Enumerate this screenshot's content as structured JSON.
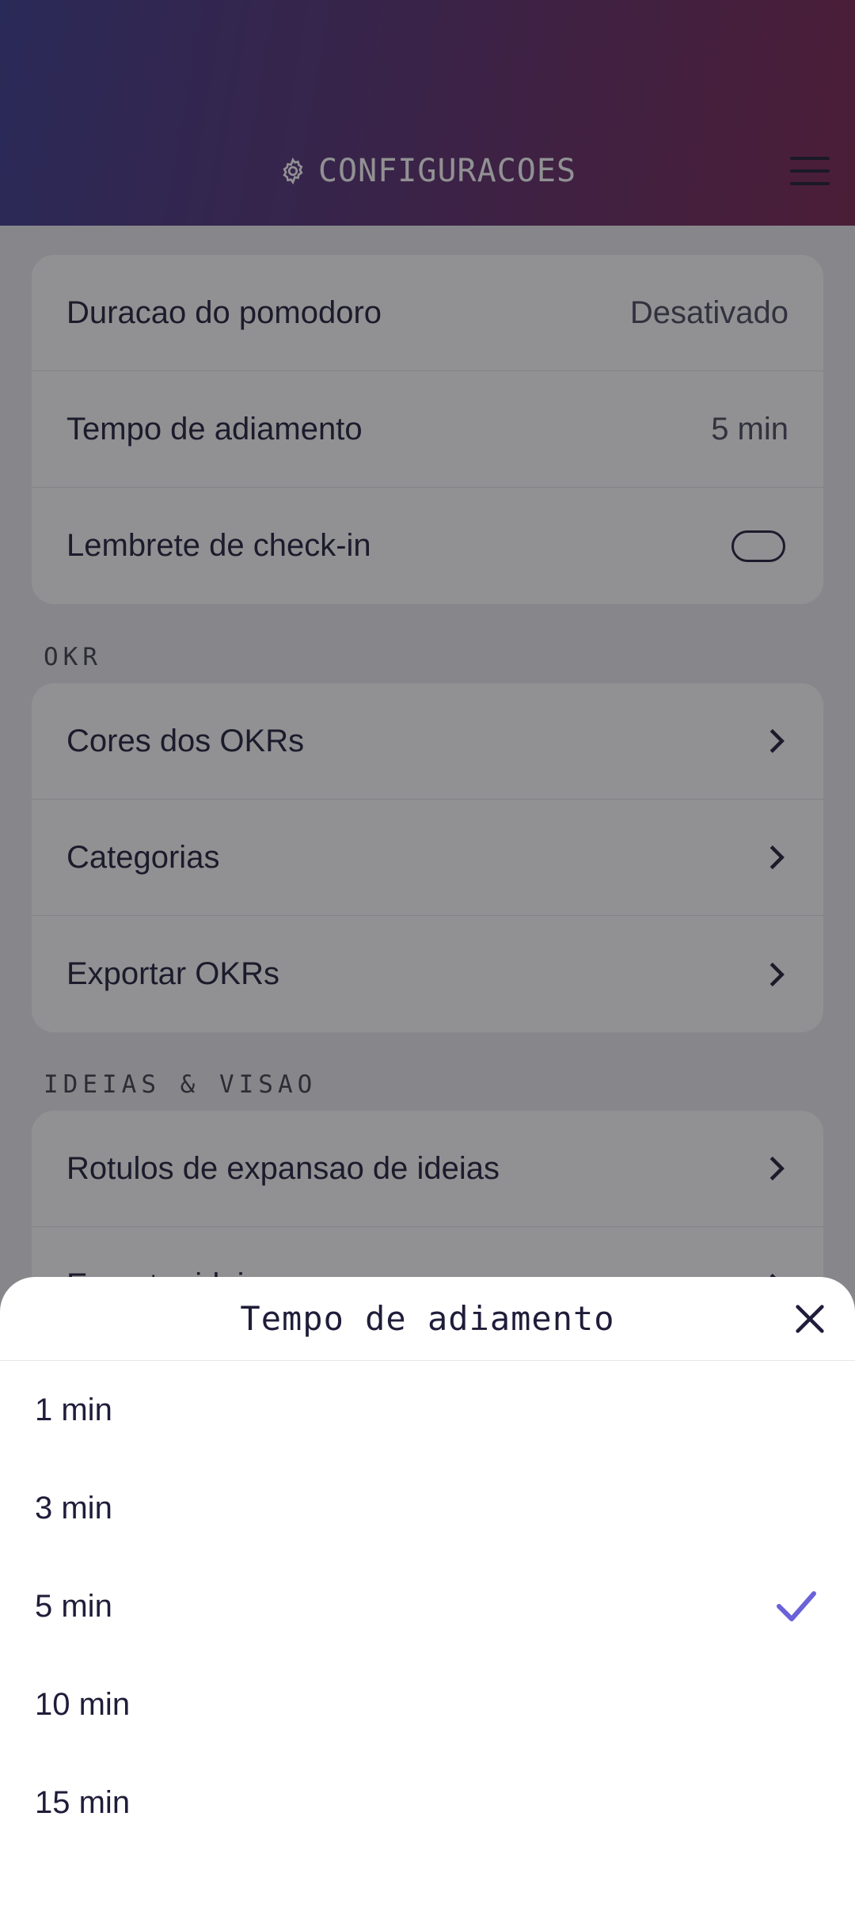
{
  "header": {
    "title": "CONFIGURACOES",
    "icon": "gear-icon",
    "menu_icon": "hamburger-menu-icon"
  },
  "sections": {
    "timer": {
      "rows": [
        {
          "label": "Duracao do pomodoro",
          "value": "Desativado"
        },
        {
          "label": "Tempo de adiamento",
          "value": "5 min"
        },
        {
          "label": "Lembrete de check-in",
          "toggle": false
        }
      ]
    },
    "okr": {
      "title": "OKR",
      "rows": [
        {
          "label": "Cores dos OKRs"
        },
        {
          "label": "Categorias"
        },
        {
          "label": "Exportar OKRs"
        }
      ]
    },
    "ideas": {
      "title": "IDEIAS & VISAO",
      "rows": [
        {
          "label": "Rotulos de expansao de ideias"
        },
        {
          "label": "Exportar ideias"
        }
      ]
    }
  },
  "sheet": {
    "title": "Tempo de adiamento",
    "close_icon": "close-icon",
    "selected": "5 min",
    "options": [
      "1 min",
      "3 min",
      "5 min",
      "10 min",
      "15 min"
    ]
  },
  "colors": {
    "accent": "#6a62d8",
    "header_gradient_start": "#3b3a8e",
    "header_gradient_end": "#7a2350",
    "text": "#1f1d3a"
  }
}
